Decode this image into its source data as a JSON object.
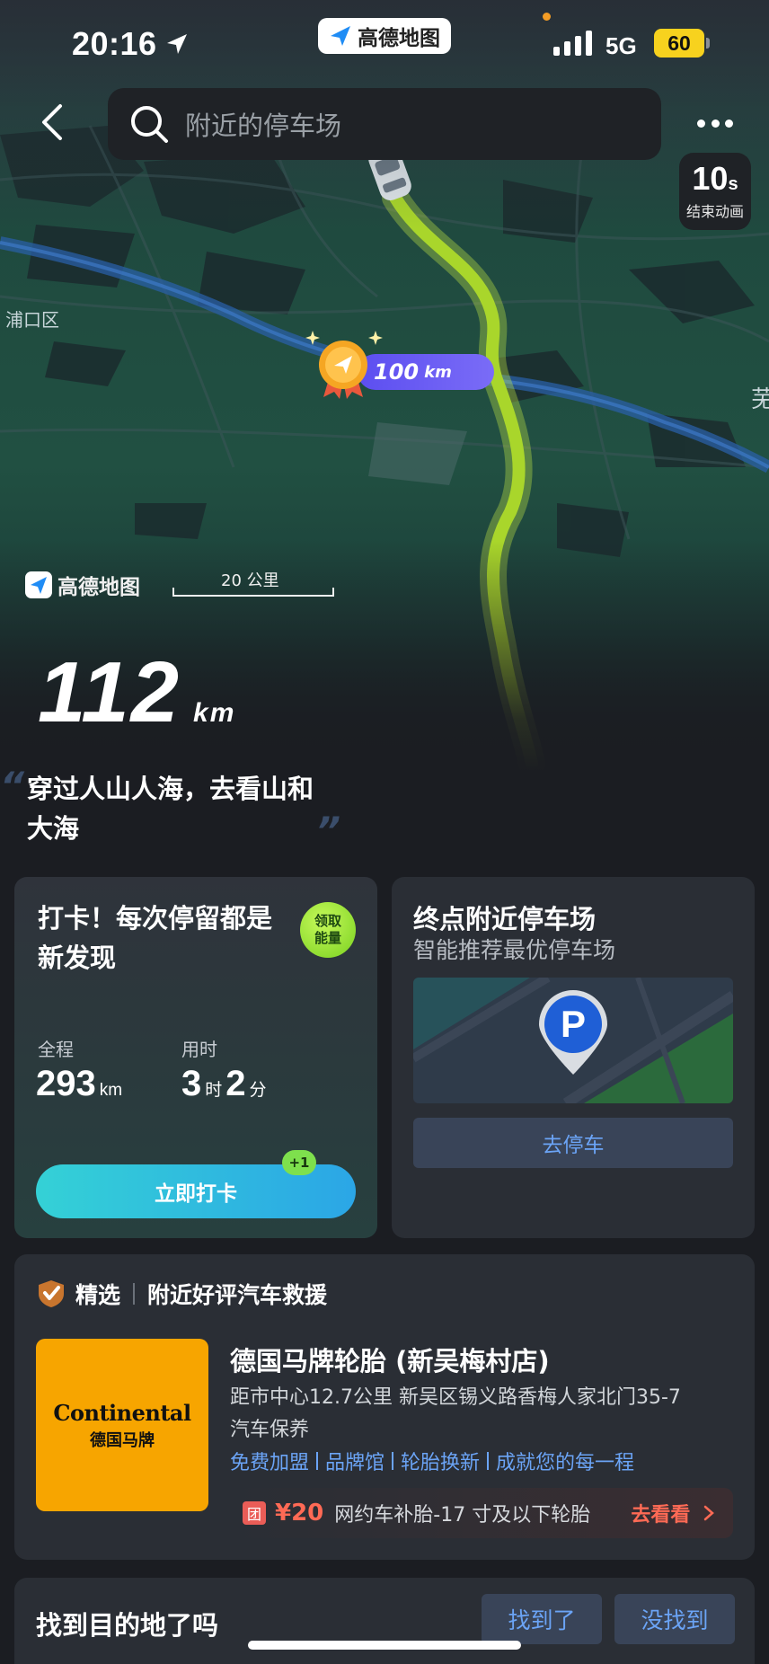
{
  "status_bar": {
    "time": "20:16",
    "app_name": "高德地图",
    "network": "5G",
    "battery": "60"
  },
  "search": {
    "placeholder": "附近的停车场"
  },
  "timer": {
    "seconds": "10",
    "unit": "s",
    "label": "结束动画"
  },
  "map": {
    "place_left": "浦口区",
    "place_right": "芜",
    "milestone": "100",
    "milestone_unit": "km",
    "logo_text": "高德地图",
    "scale": "20 公里",
    "total_distance": "112",
    "distance_unit": "km"
  },
  "quote": {
    "open_mark": "“",
    "text": "穿过人山人海，去看山和大海",
    "close_mark": "”"
  },
  "checkin_card": {
    "title": "打卡！每次停留都是新发现",
    "energy_badge_line1": "领取",
    "energy_badge_line2": "能量",
    "distance_label": "全程",
    "distance_value": "293",
    "distance_unit": "km",
    "time_label": "用时",
    "hours": "3",
    "hours_unit": "时",
    "minutes": "2",
    "minutes_unit": "分",
    "button": "立即打卡",
    "plus_badge": "+1"
  },
  "parking_card": {
    "title": "终点附近停车场",
    "subtitle": "智能推荐最优停车场",
    "pin_letter": "P",
    "button": "去停车"
  },
  "recommend": {
    "tag": "精选",
    "heading": "附近好评汽车救援",
    "logo_en": "Continental",
    "logo_cn": "德国马牌",
    "shop_name": "德国马牌轮胎 (新吴梅村店)",
    "address": "距市中心12.7公里  新吴区锡义路香梅人家北门35-7",
    "category": "汽车保养",
    "tags": [
      "免费加盟",
      "品牌馆",
      "轮胎换新",
      "成就您的每一程"
    ],
    "deal_icon": "团",
    "deal_price": "¥20",
    "deal_desc": "网约车补胎-17 寸及以下轮胎",
    "deal_action": "去看看"
  },
  "found_bar": {
    "question": "找到目的地了吗",
    "yes": "找到了",
    "no": "没找到"
  },
  "colors": {
    "accent_blue": "#6ba4f6",
    "route_green": "#a9d62b",
    "deal_red": "#ff6a55",
    "battery_yellow": "#f7d21e"
  }
}
